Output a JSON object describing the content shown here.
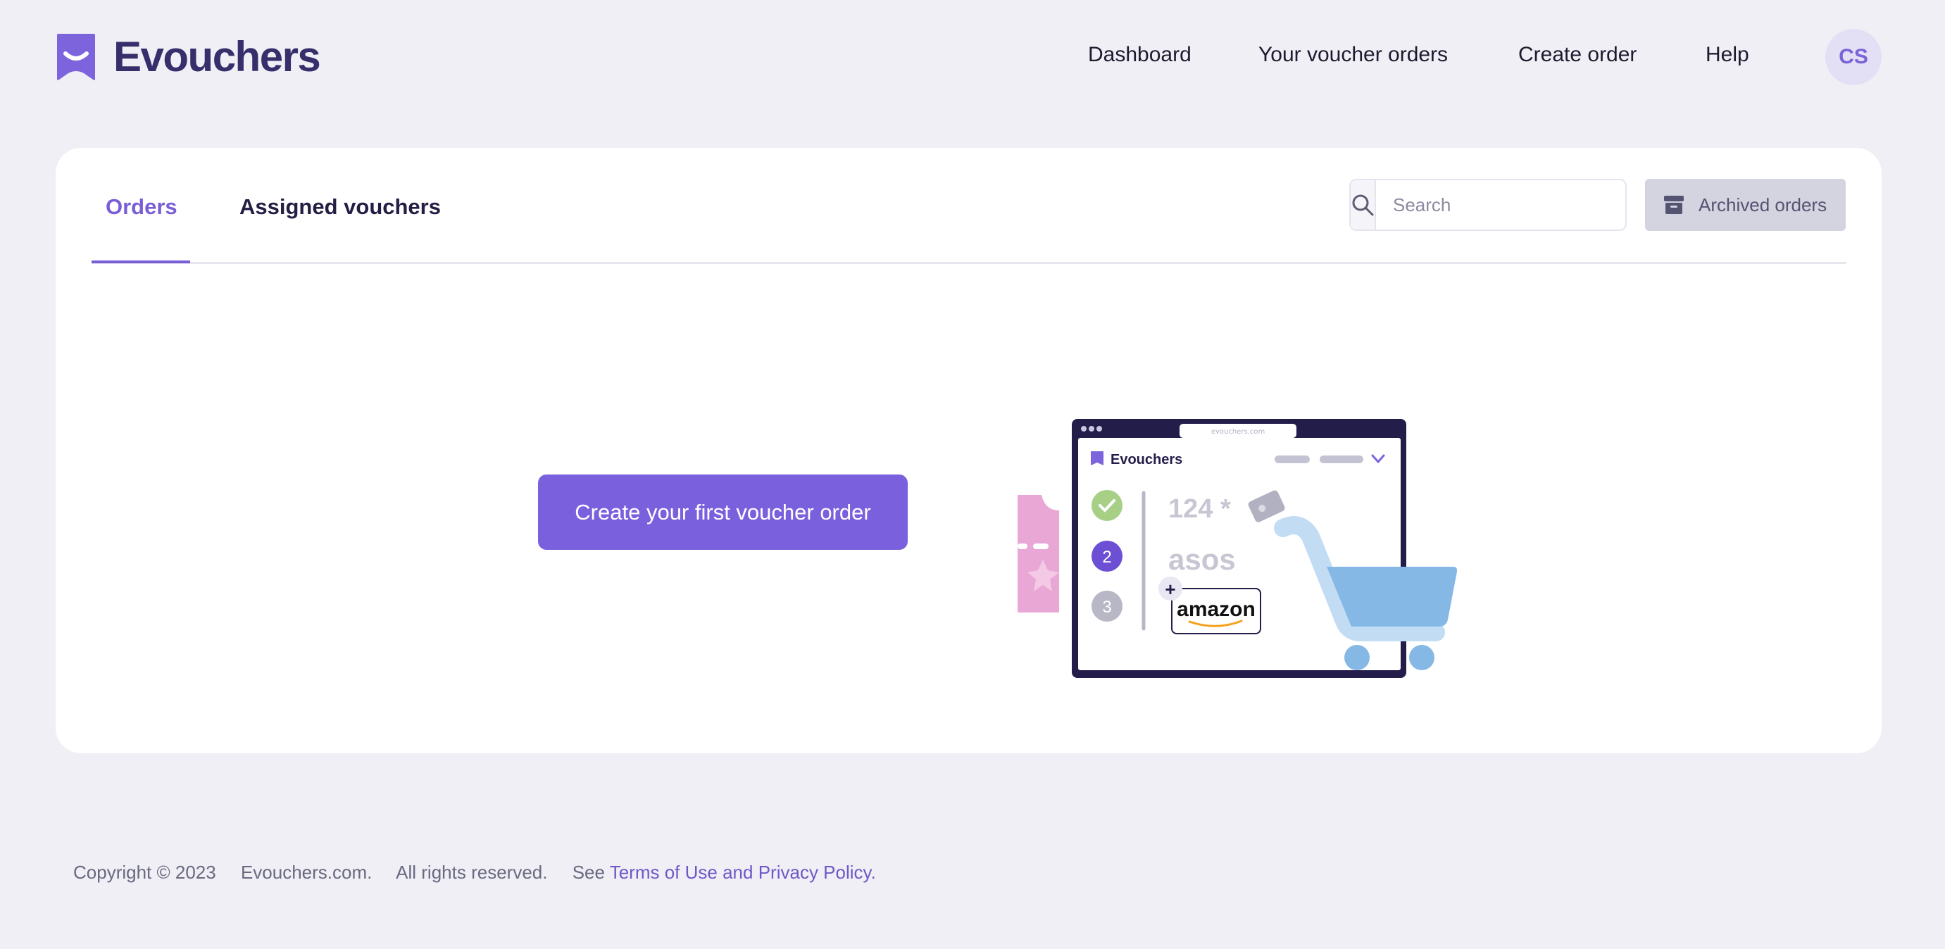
{
  "app": {
    "name": "Evouchers"
  },
  "header": {
    "nav": [
      {
        "label": "Dashboard"
      },
      {
        "label": "Your voucher orders"
      },
      {
        "label": "Create order"
      },
      {
        "label": "Help"
      }
    ],
    "avatar_initials": "CS"
  },
  "orders_page": {
    "tabs": [
      {
        "label": "Orders",
        "active": true
      },
      {
        "label": "Assigned vouchers",
        "active": false
      }
    ],
    "search": {
      "placeholder": "Search",
      "value": ""
    },
    "archived_button_label": "Archived orders",
    "empty_state_button_label": "Create your first voucher order"
  },
  "illustration": {
    "url_text": "evouchers.com",
    "brand": "Evouchers",
    "steps": [
      "2",
      "3"
    ],
    "item_1": "124 *",
    "item_2": "asos",
    "item_3": "amazon",
    "plus": "+"
  },
  "footer": {
    "copyright": "Copyright © 2023",
    "site": "Evouchers.com.",
    "rights": "All rights reserved.",
    "see": "See",
    "terms_link": "Terms of Use",
    "and": "and",
    "privacy_link": "Privacy Policy."
  },
  "colors": {
    "accent": "#7a5ed8",
    "background": "#efeff5",
    "brand_text": "#372f6b"
  }
}
